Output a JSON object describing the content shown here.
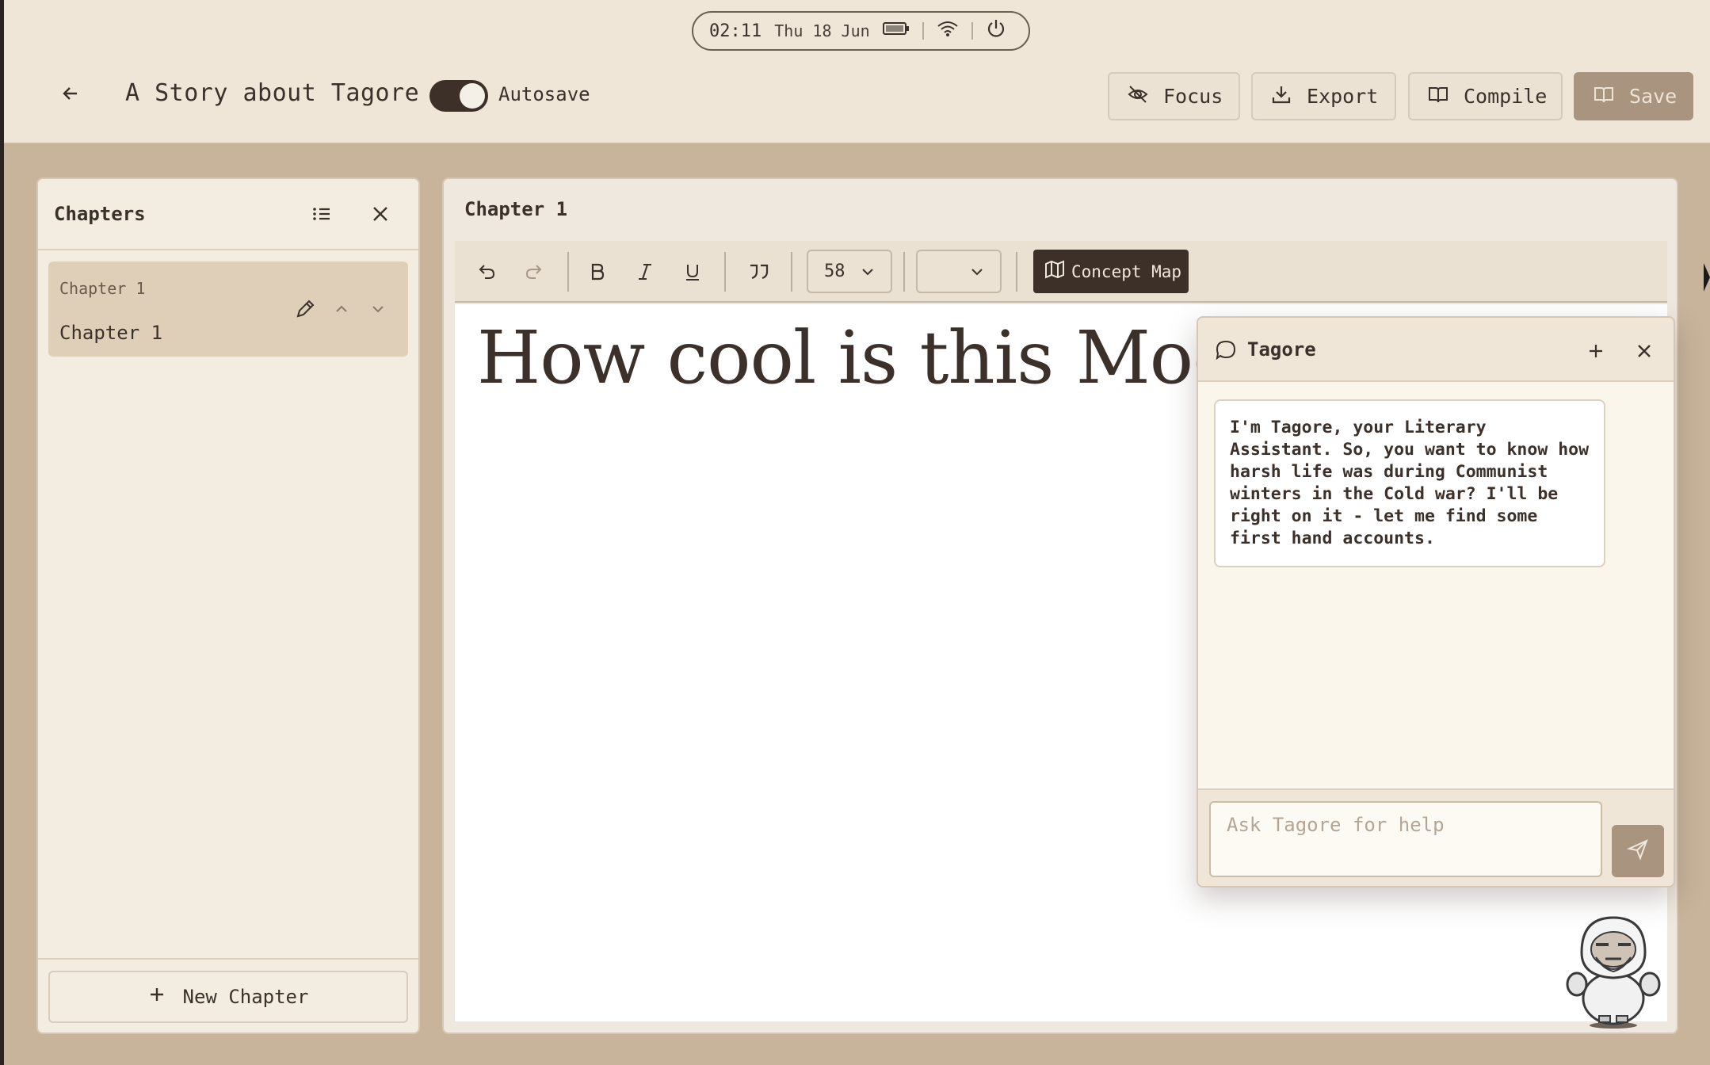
{
  "status_bar": {
    "time": "02:11",
    "date": "Thu 18 Jun"
  },
  "header": {
    "title": "A Story about Tagore",
    "autosave_label": "Autosave",
    "autosave_on": true,
    "buttons": {
      "focus": "Focus",
      "export": "Export",
      "compile": "Compile",
      "save": "Save"
    }
  },
  "chapters_panel": {
    "title": "Chapters",
    "items": [
      {
        "subtitle": "Chapter 1",
        "name": "Chapter 1"
      }
    ],
    "new_chapter_label": "New Chapter"
  },
  "editor": {
    "chapter_title": "Chapter 1",
    "font_size": "58",
    "font_family": "",
    "concept_map_label": "Concept Map",
    "content": "How cool is this Mod"
  },
  "assistant": {
    "title": "Tagore",
    "message": "I'm Tagore, your Literary Assistant. So, you want to know how harsh life was during Communist winters in the Cold war? I'll be right on it - let me find some first hand accounts.",
    "input_placeholder": "Ask Tagore for help"
  },
  "colors": {
    "background": "#c7b49a",
    "panel": "#efe6d8",
    "accent_dark": "#3d3028",
    "save_button": "#a99480"
  }
}
